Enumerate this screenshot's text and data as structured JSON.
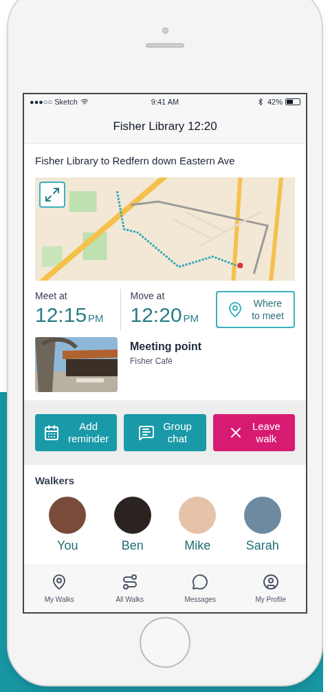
{
  "status_bar": {
    "carrier": "●●●○○ Sketch",
    "time": "9:41 AM",
    "battery": "42%"
  },
  "nav": {
    "title": "Fisher Library 12:20"
  },
  "route": {
    "title": "Fisher Library to Redfern down Eastern Ave"
  },
  "times": [
    {
      "label": "Meet at",
      "time": "12:15",
      "suffix": "PM"
    },
    {
      "label": "Move at",
      "time": "12:20",
      "suffix": "PM"
    }
  ],
  "where_button": {
    "lines": [
      "Where",
      "to meet"
    ]
  },
  "meeting_point": {
    "title": "Meeting point",
    "place": "Fisher Café"
  },
  "actions": [
    {
      "kind": "reminder",
      "lines": [
        "Add",
        "reminder"
      ],
      "color": "#1a9aa8"
    },
    {
      "kind": "chat",
      "lines": [
        "Group",
        "chat"
      ],
      "color": "#1a9aa8"
    },
    {
      "kind": "leave",
      "lines": [
        "Leave",
        "walk"
      ],
      "color": "#d81b72"
    }
  ],
  "walkers": {
    "title": "Walkers",
    "people": [
      {
        "name": "You",
        "color": "#7a4a3a"
      },
      {
        "name": "Ben",
        "color": "#2a2320"
      },
      {
        "name": "Mike",
        "color": "#e6c2a8"
      },
      {
        "name": "Sarah",
        "color": "#6d8aa0"
      }
    ]
  },
  "tab_bar": [
    {
      "kind": "pin",
      "label": "My Walks"
    },
    {
      "kind": "route",
      "label": "All Walks"
    },
    {
      "kind": "chat",
      "label": "Messages"
    },
    {
      "kind": "profile",
      "label": "My Profile"
    }
  ]
}
